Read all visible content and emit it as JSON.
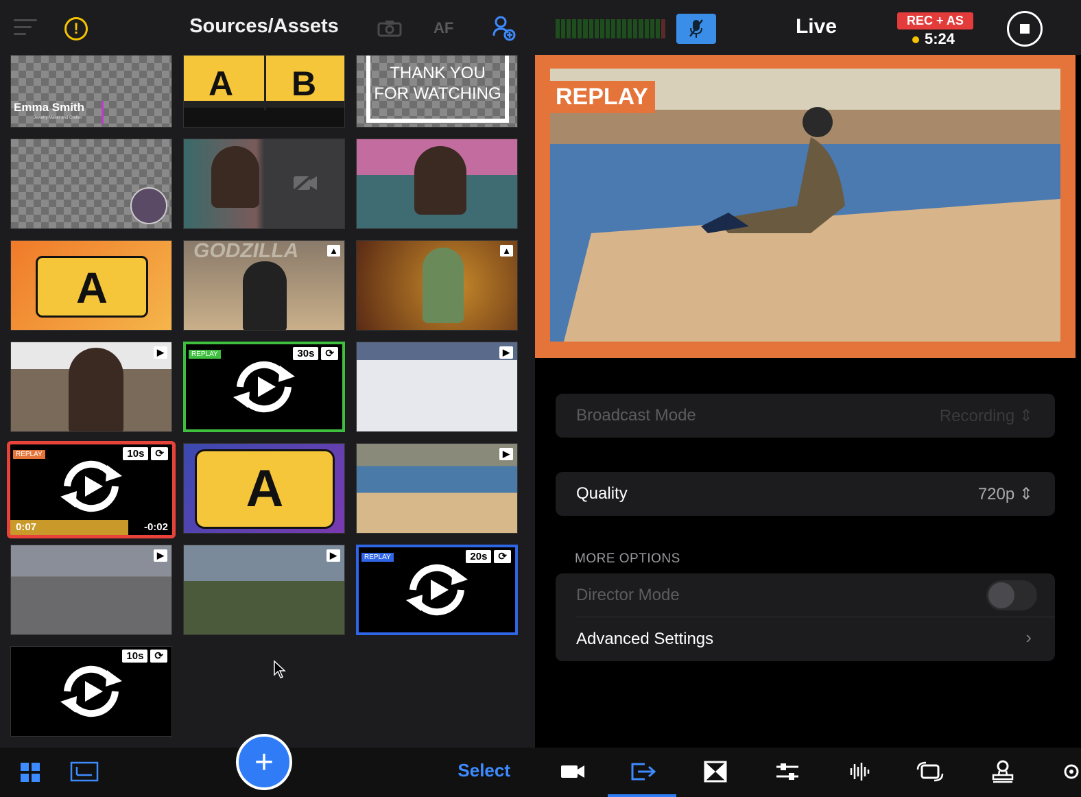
{
  "left_panel": {
    "title": "Sources/Assets",
    "af_label": "AF",
    "select_label": "Select",
    "tiles": {
      "lower_third_name": "Emma Smith",
      "lower_third_sub": "Jewelry Maker and Crafter",
      "thank_you_line1": "THANK YOU",
      "thank_you_line2": "FOR WATCHING",
      "letter_a": "A",
      "letter_b": "B",
      "replay_tag": "REPLAY",
      "replay_30s": "30s",
      "replay_10s": "10s",
      "replay_20s": "20s",
      "replay_elapsed": "0:07",
      "replay_remaining": "-0:02",
      "godzilla_text": "GODZILLA"
    }
  },
  "right_panel": {
    "title": "Live",
    "rec_badge": "REC + AS",
    "rec_time": "5:24",
    "replay_label": "REPLAY",
    "broadcast_mode_label": "Broadcast Mode",
    "broadcast_mode_value": "Recording",
    "quality_label": "Quality",
    "quality_value": "720p",
    "more_options_header": "MORE OPTIONS",
    "director_mode_label": "Director Mode",
    "advanced_settings_label": "Advanced Settings"
  },
  "colors": {
    "accent_blue": "#2f7cf6",
    "rec_red": "#e43b3b",
    "replay_orange": "#e5743a",
    "selected_green": "#3fbf3f",
    "selected_red": "#e8433a",
    "selected_blue": "#2f66e8",
    "warning_yellow": "#f5c400"
  }
}
